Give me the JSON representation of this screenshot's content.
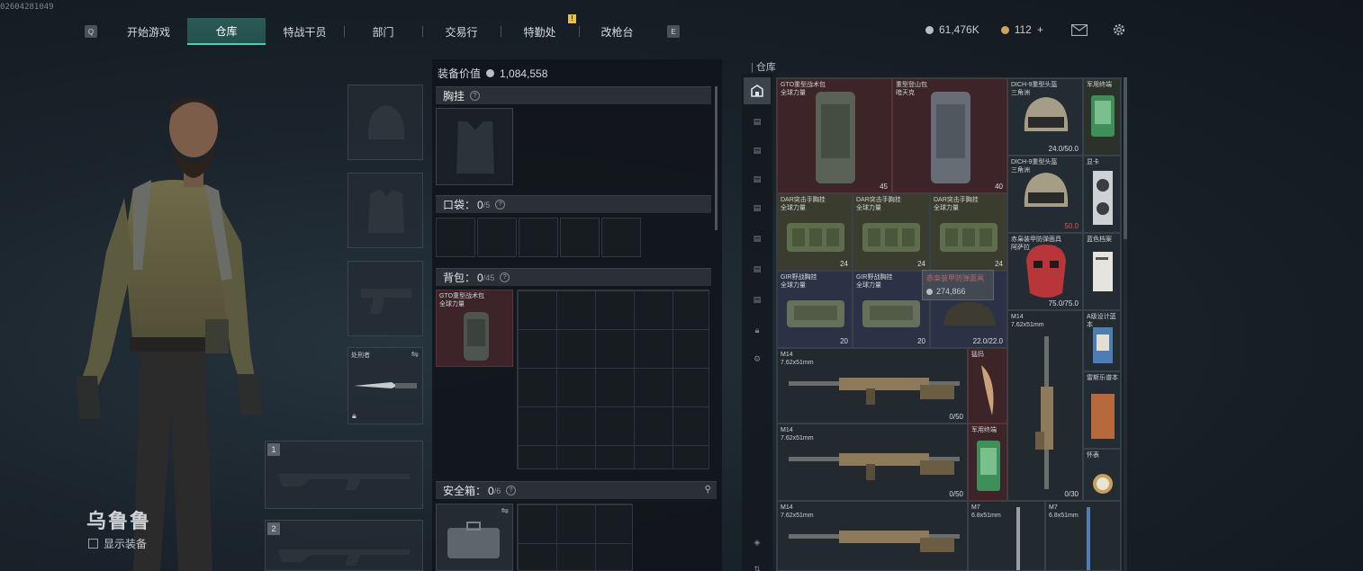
{
  "build_id": "02604281049",
  "nav": {
    "left_key": "Q",
    "right_key": "E",
    "tabs": [
      "开始游戏",
      "仓库",
      "特战干员",
      "部门",
      "交易行",
      "特勤处",
      "改枪台"
    ],
    "active_index": 1,
    "badge": "!"
  },
  "currency": {
    "coins": "61,476K",
    "tokens": "112",
    "plus": "+"
  },
  "icons": {
    "mail": "mail-icon",
    "settings": "gear-icon"
  },
  "character": {
    "name": "乌鲁鲁",
    "show_equipment_label": "显示装备"
  },
  "equipment_slots": {
    "melee_label": "处刑者",
    "slot_1": "1",
    "slot_2": "2"
  },
  "loadout": {
    "value_label": "装备价值",
    "value": "1,084,558",
    "chest_rig_label": "胸挂",
    "pockets_label": "口袋：",
    "pockets_used": "0",
    "pockets_max": "/5",
    "backpack_label": "背包：",
    "backpack_used": "0",
    "backpack_max": "/45",
    "backpack_item": "GTO重型战术包\n全球力量",
    "safe_box_label": "安全箱：",
    "safe_box_used": "0",
    "safe_box_max": "/6"
  },
  "warehouse": {
    "label": "仓库",
    "items": [
      {
        "name": "GTO重型战术包\n全球力量",
        "count": "45"
      },
      {
        "name": "重型登山包\n暗天克",
        "count": "40"
      },
      {
        "name": "DICH-9重型头盔\n三角洲",
        "count": "24.0/50.0"
      },
      {
        "name": "军用终端",
        "count": ""
      },
      {
        "name": "DICH-9重型头盔\n三角洲",
        "count": "50.0"
      },
      {
        "name": "显卡",
        "count": ""
      },
      {
        "name": "DAR突击手胸挂\n全球力量",
        "count": "24"
      },
      {
        "name": "DAR突击手胸挂\n全球力量",
        "count": "24"
      },
      {
        "name": "DAR突击手胸挂\n全球力量",
        "count": "24"
      },
      {
        "name": "赤枭装甲防弹面具\n阿萨拉",
        "count": "75.0/75.0"
      },
      {
        "name": "蓝色档案",
        "count": ""
      },
      {
        "name": "GIR野战胸挂\n全球力量",
        "count": "20"
      },
      {
        "name": "GIR野战胸挂\n全球力量",
        "count": "20"
      },
      {
        "name": "",
        "count": "22.0/22.0"
      },
      {
        "name": "M14\n7.62x51mm",
        "count": "0/30"
      },
      {
        "name": "A级设计蓝本",
        "count": ""
      },
      {
        "name": "M14\n7.62x51mm",
        "count": "0/50"
      },
      {
        "name": "猛犸",
        "count": ""
      },
      {
        "name": "雷斯乐谱本",
        "count": ""
      },
      {
        "name": "M14\n7.62x51mm",
        "count": "0/50"
      },
      {
        "name": "军用终端",
        "count": ""
      },
      {
        "name": "怀表",
        "count": ""
      },
      {
        "name": "M14\n7.62x51mm",
        "count": ""
      },
      {
        "name": "M7\n6.8x51mm",
        "count": ""
      },
      {
        "name": "M7\n6.8x51mm",
        "count": ""
      }
    ],
    "tooltip_title": "赤枭装甲防弹面具",
    "tooltip_value": "274,866"
  }
}
